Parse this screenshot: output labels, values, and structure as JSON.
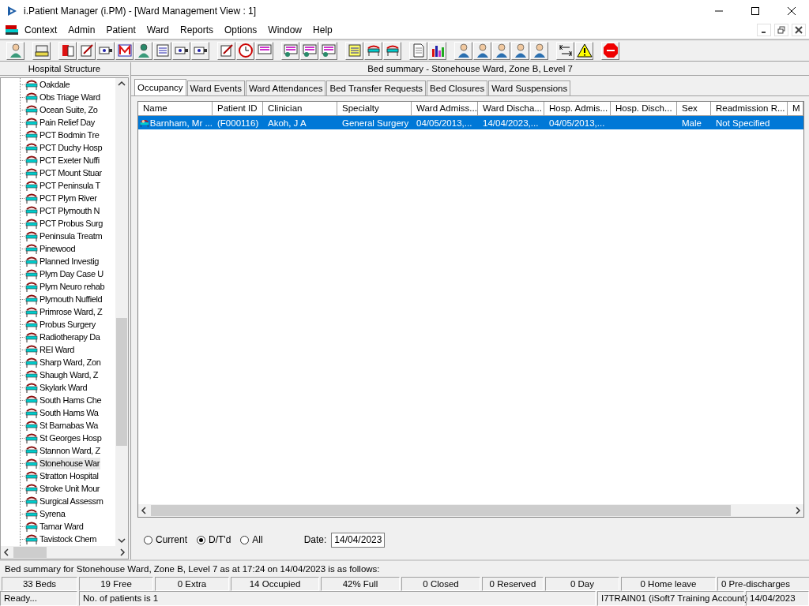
{
  "window": {
    "title": "i.Patient Manager (i.PM) - [Ward Management View : 1]"
  },
  "menu": [
    "Context",
    "Admin",
    "Patient",
    "Ward",
    "Reports",
    "Options",
    "Window",
    "Help"
  ],
  "left_pane": {
    "title": "Hospital Structure",
    "items": [
      {
        "label": "Oakdale",
        "selected": false
      },
      {
        "label": "Obs Triage Ward",
        "selected": false
      },
      {
        "label": "Ocean Suite, Zo",
        "selected": false
      },
      {
        "label": "Pain Relief Day",
        "selected": false
      },
      {
        "label": "PCT Bodmin Tre",
        "selected": false
      },
      {
        "label": "PCT Duchy Hosp",
        "selected": false
      },
      {
        "label": "PCT Exeter Nuffi",
        "selected": false
      },
      {
        "label": "PCT Mount Stuar",
        "selected": false
      },
      {
        "label": "PCT Peninsula T",
        "selected": false
      },
      {
        "label": "PCT Plym River",
        "selected": false
      },
      {
        "label": "PCT Plymouth N",
        "selected": false
      },
      {
        "label": "PCT Probus Surg",
        "selected": false
      },
      {
        "label": "Peninsula Treatm",
        "selected": false
      },
      {
        "label": "Pinewood",
        "selected": false
      },
      {
        "label": "Planned Investig",
        "selected": false
      },
      {
        "label": "Plym Day Case U",
        "selected": false
      },
      {
        "label": "Plym Neuro rehab",
        "selected": false
      },
      {
        "label": "Plymouth Nuffield",
        "selected": false
      },
      {
        "label": "Primrose Ward, Z",
        "selected": false
      },
      {
        "label": "Probus Surgery",
        "selected": false
      },
      {
        "label": "Radiotherapy Da",
        "selected": false
      },
      {
        "label": "REI Ward",
        "selected": false
      },
      {
        "label": "Sharp Ward, Zon",
        "selected": false
      },
      {
        "label": "Shaugh Ward, Z",
        "selected": false
      },
      {
        "label": "Skylark Ward",
        "selected": false
      },
      {
        "label": "South Hams Che",
        "selected": false
      },
      {
        "label": "South Hams Wa",
        "selected": false
      },
      {
        "label": "St Barnabas Wa",
        "selected": false
      },
      {
        "label": "St Georges Hosp",
        "selected": false
      },
      {
        "label": "Stannon Ward, Z",
        "selected": false
      },
      {
        "label": "Stonehouse War",
        "selected": true
      },
      {
        "label": "Stratton Hospital",
        "selected": false
      },
      {
        "label": "Stroke Unit Mour",
        "selected": false
      },
      {
        "label": "Surgical Assessm",
        "selected": false
      },
      {
        "label": "Syrena",
        "selected": false
      },
      {
        "label": "Tamar Ward",
        "selected": false
      },
      {
        "label": "Tavistock Chem",
        "selected": false
      }
    ]
  },
  "right_pane": {
    "title": "Bed summary - Stonehouse Ward, Zone B, Level 7"
  },
  "tabs": [
    {
      "label": "Occupancy",
      "selected": true
    },
    {
      "label": "Ward Events",
      "selected": false
    },
    {
      "label": "Ward Attendances",
      "selected": false
    },
    {
      "label": "Bed Transfer Requests",
      "selected": false
    },
    {
      "label": "Bed Closures",
      "selected": false
    },
    {
      "label": "Ward Suspensions",
      "selected": false
    }
  ],
  "table": {
    "columns": [
      "Name",
      "Patient ID",
      "Clinician",
      "Specialty",
      "Ward Admiss...",
      "Ward Discha...",
      "Hosp. Admis...",
      "Hosp. Disch...",
      "Sex",
      "Readmission R...",
      "M"
    ],
    "rows": [
      {
        "selected": true,
        "cells": [
          "Barnham, Mr ...",
          "(F000116)",
          "Akoh, J A",
          "General Surgery",
          "04/05/2013,...",
          "14/04/2023,...",
          "04/05/2013,...",
          "",
          "Male",
          "Not Specified",
          ""
        ]
      }
    ]
  },
  "filter": {
    "options": [
      {
        "label": "Current",
        "selected": false
      },
      {
        "label": "D/T'd",
        "selected": true
      },
      {
        "label": "All",
        "selected": false
      }
    ],
    "date_label": "Date:",
    "date": "14/04/2023"
  },
  "summary": "Bed summary for Stonehouse Ward, Zone B, Level 7 as at 17:24 on 14/04/2023 is as follows:",
  "stats": [
    "33 Beds",
    "19 Free",
    "0 Extra",
    "14 Occupied",
    "42% Full",
    "0 Closed",
    "0 Reserved",
    "0 Day",
    "0 Home leave",
    "0 Pre-discharges"
  ],
  "status_bar": [
    "Ready...",
    "No. of patients is 1",
    "I7TRAIN01 (iSoft7 Training Account)",
    "14/04/2023"
  ]
}
